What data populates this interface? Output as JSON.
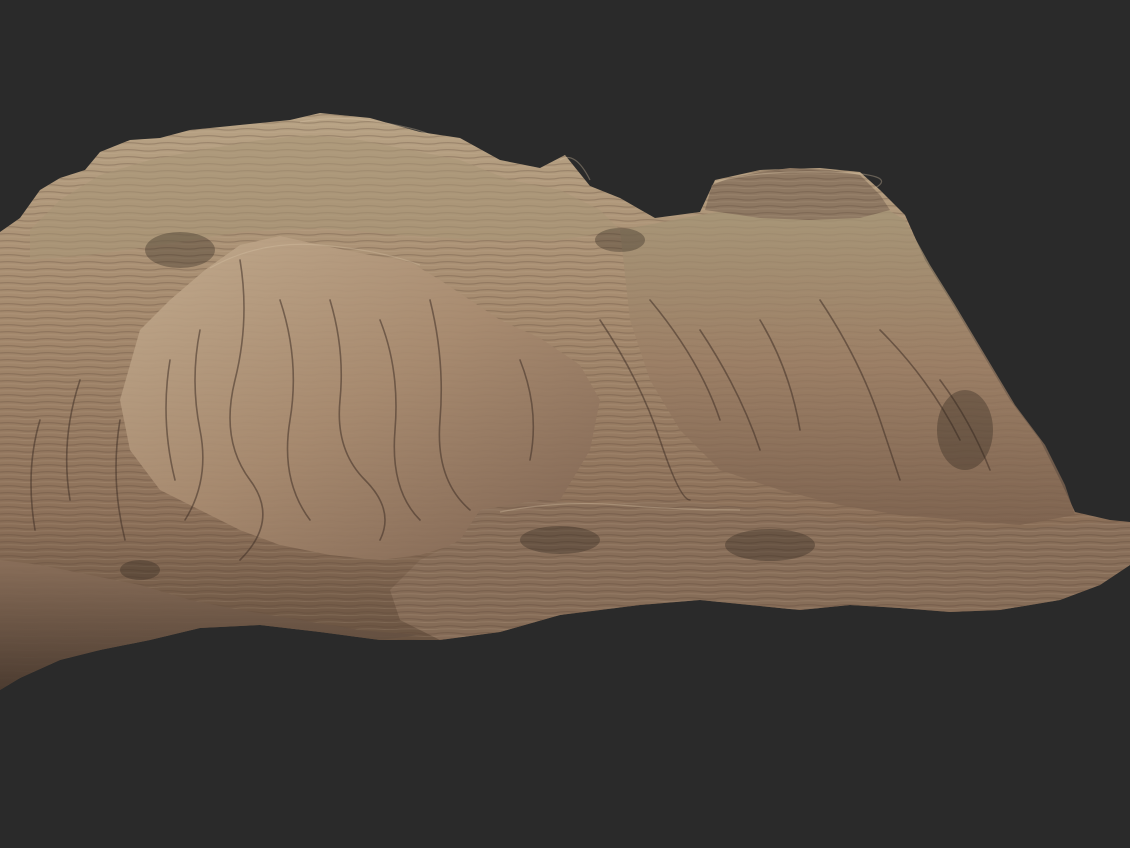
{
  "scene": {
    "background_color": "#2a2a2a",
    "subject": "terrain-model",
    "palette": {
      "rock_light": "#c2a98c",
      "rock_mid": "#9a7f66",
      "rock_dark": "#5e4a3b",
      "rock_shadow": "#3b2f27",
      "rock_green_tint": "#a59f80",
      "rock_red_tint": "#8f6a55"
    }
  }
}
